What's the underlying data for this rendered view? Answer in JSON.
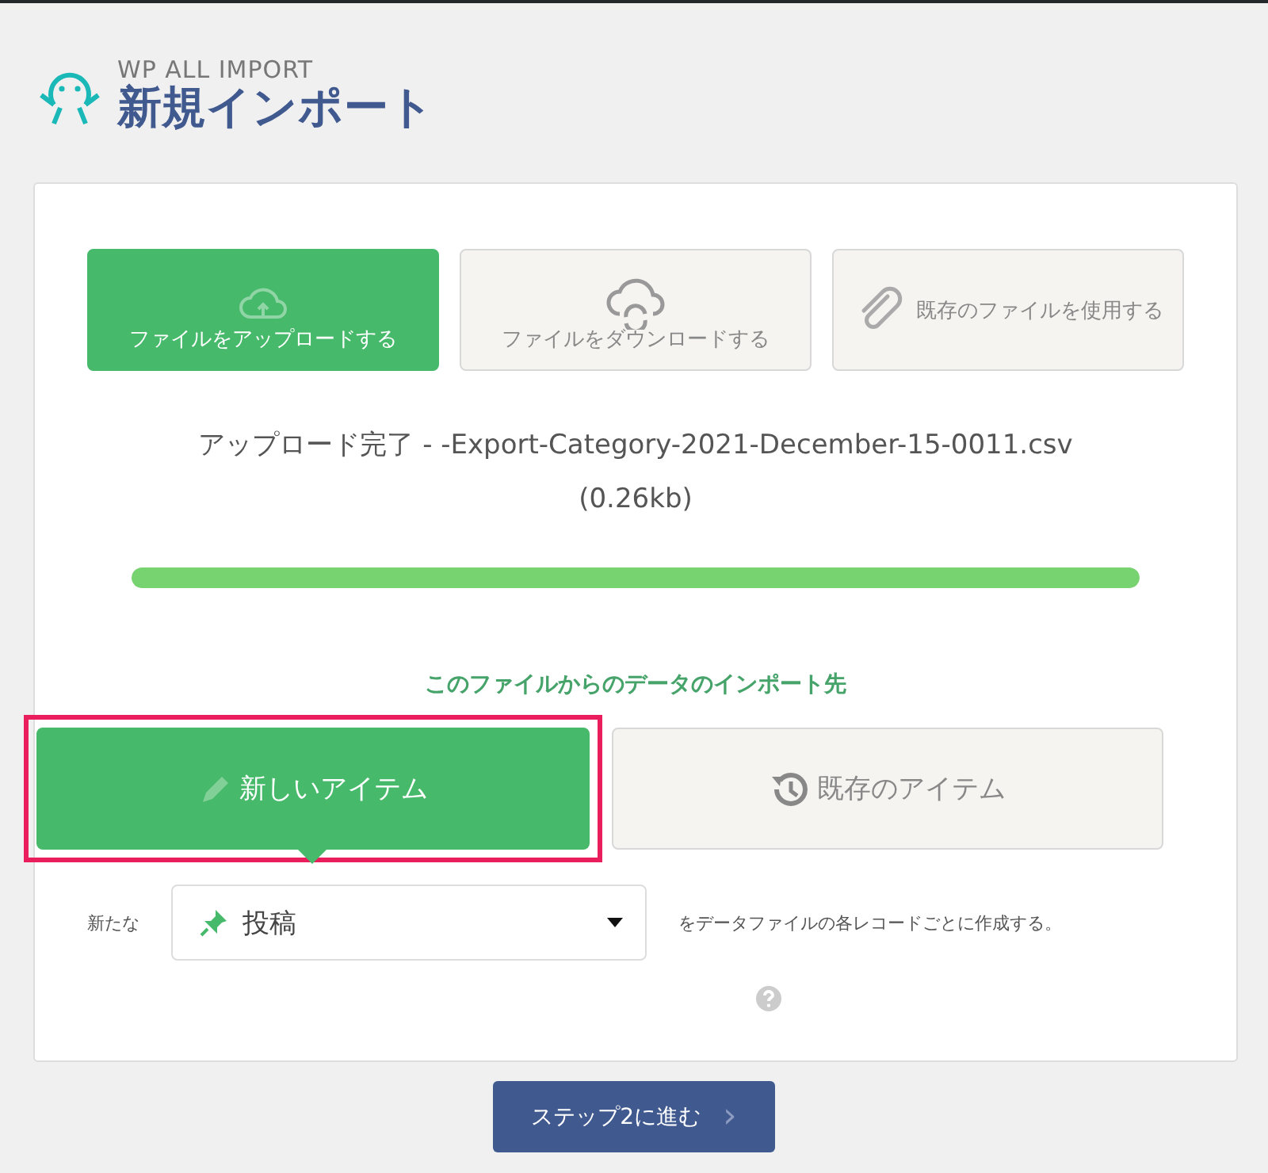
{
  "header": {
    "brand": "WP ALL IMPORT",
    "title": "新規インポート"
  },
  "sources": [
    {
      "kind": "upload",
      "label": "ファイルをアップロードする",
      "selected": true
    },
    {
      "kind": "download",
      "label": "ファイルをダウンロードする",
      "selected": false
    },
    {
      "kind": "existing",
      "label": "既存のファイルを使用する",
      "selected": false
    }
  ],
  "upload_status": {
    "message": "アップロード完了 - ",
    "filename": "-Export-Category-2021-December-15-0011.csv",
    "size": "(0.26kb)",
    "level": 1
  },
  "import_target": {
    "heading": "このファイルからのデータのインポート先",
    "options": [
      {
        "kind": "new",
        "label": "新しいアイテム",
        "selected": true,
        "highlighted": true
      },
      {
        "kind": "existing",
        "label": "既存のアイテム",
        "selected": false,
        "highlighted": false
      }
    ]
  },
  "create_row": {
    "prefix": "新たな",
    "select_value": "投稿",
    "suffix": "をデータファイルの各レコードごとに作成する。"
  },
  "next_button": {
    "label": "ステップ2に進む",
    "arrow": "›"
  }
}
